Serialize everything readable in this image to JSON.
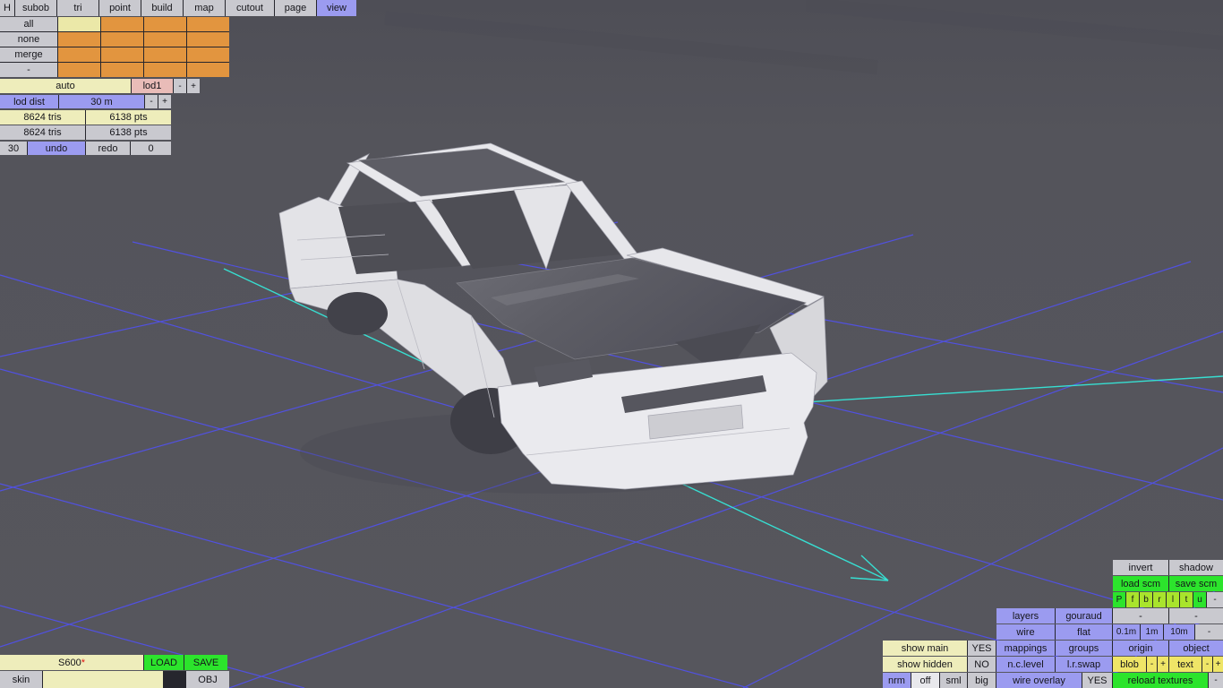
{
  "topbar": {
    "items": [
      {
        "label": "H"
      },
      {
        "label": "subob"
      },
      {
        "label": "tri"
      },
      {
        "label": "point"
      },
      {
        "label": "build"
      },
      {
        "label": "map"
      },
      {
        "label": "cutout"
      },
      {
        "label": "page"
      },
      {
        "label": "view"
      }
    ],
    "active": "view"
  },
  "selection": {
    "buttons": [
      {
        "label": "all"
      },
      {
        "label": "none"
      },
      {
        "label": "merge"
      },
      {
        "label": "-"
      }
    ]
  },
  "lod": {
    "auto": "auto",
    "level": "lod1",
    "minus": "-",
    "plus": "+",
    "dist_label": "lod dist",
    "dist_value": "30 m",
    "dist_minus": "-",
    "dist_plus": "+"
  },
  "stats": {
    "row1_tris": "8624 tris",
    "row1_pts": "6138 pts",
    "row2_tris": "8624 tris",
    "row2_pts": "6138 pts"
  },
  "history": {
    "undo_steps": "30",
    "undo": "undo",
    "redo": "redo",
    "redo_steps": "0"
  },
  "file": {
    "name": "S600",
    "modified": "*",
    "load": "LOAD",
    "save": "SAVE",
    "skin": "skin",
    "obj": "OBJ"
  },
  "panel": {
    "invert": "invert",
    "shadow": "shadow",
    "load_scm": "load scm",
    "save_scm": "save scm",
    "faces": [
      {
        "label": "P"
      },
      {
        "label": "f"
      },
      {
        "label": "b"
      },
      {
        "label": "r"
      },
      {
        "label": "l"
      },
      {
        "label": "t"
      },
      {
        "label": "u"
      },
      {
        "label": "-"
      }
    ],
    "layers": "layers",
    "gouraud": "gouraud",
    "slot1": "-",
    "slot2": "-",
    "wire": "wire",
    "flat": "flat",
    "g01": "0.1m",
    "g1": "1m",
    "g10": "10m",
    "gdash": "-",
    "show_main": "show main",
    "show_main_val": "YES",
    "mappings": "mappings",
    "groups": "groups",
    "origin": "origin",
    "object": "object",
    "show_hidden": "show hidden",
    "show_hidden_val": "NO",
    "nc_level": "n.c.level",
    "lr_swap": "l.r.swap",
    "blob": "blob",
    "blob_minus": "-",
    "blob_plus": "+",
    "text": "text",
    "text_minus": "-",
    "text_plus": "+",
    "nrm": "nrm",
    "off": "off",
    "sml": "sml",
    "big": "big",
    "wire_overlay": "wire overlay",
    "wire_overlay_val": "YES",
    "reload_textures": "reload textures",
    "reload_dash": "-"
  },
  "colors": {
    "accent_purple": "#9b9bf0",
    "button_gray": "#c9c9cf",
    "cream": "#eeedbb",
    "orange": "#e2953f",
    "green": "#2ce42c",
    "yellow": "#efe567",
    "pink": "#e9bcb8",
    "grid_blue": "#5151ef",
    "axis_cyan": "#37dfd2"
  }
}
